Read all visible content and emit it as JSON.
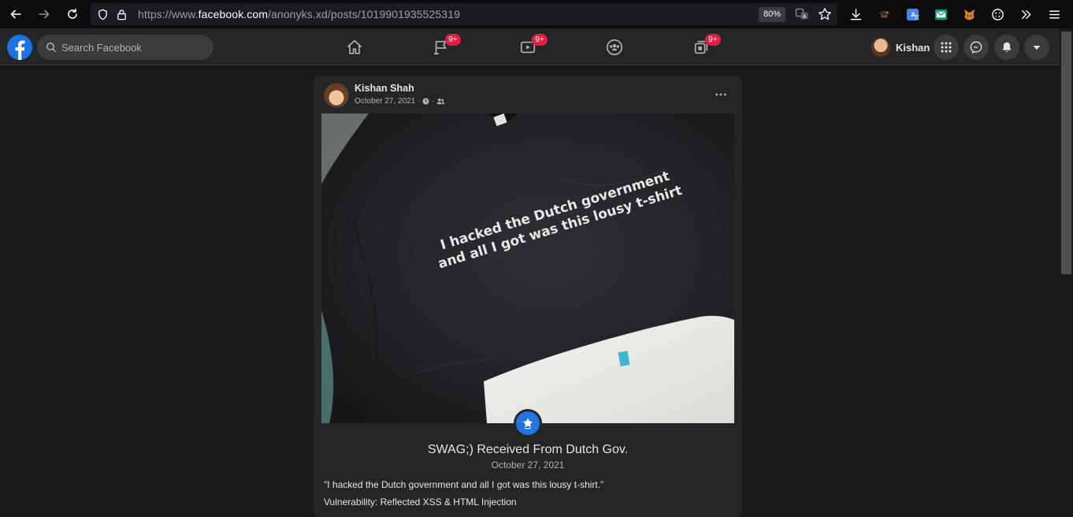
{
  "browser": {
    "url_prefix": "https://www.",
    "url_host": "facebook.com",
    "url_path": "/anonyks.xd/posts/1019901935525319",
    "zoom": "80%"
  },
  "fb": {
    "search_placeholder": "Search Facebook",
    "nav": [
      {
        "name": "home",
        "badge": ""
      },
      {
        "name": "pages",
        "badge": "9+"
      },
      {
        "name": "watch",
        "badge": "9+"
      },
      {
        "name": "groups",
        "badge": ""
      },
      {
        "name": "gaming",
        "badge": "9+"
      }
    ],
    "profile_name": "Kishan"
  },
  "post": {
    "author": "Kishan Shah",
    "date": "October 27, 2021 ·",
    "photo_caption_line1": "I hacked the Dutch government",
    "photo_caption_line2": "and all I got was this lousy t-shirt",
    "milestone_title": "SWAG;) Received From Dutch Gov.",
    "milestone_date": "October 27, 2021",
    "text_line1": "\"I hacked the Dutch government and all I got was this lousy t-shirt.\"",
    "text_line2": "Vulnerability: Reflected XSS & HTML Injection"
  },
  "colors": {
    "accent": "#1b74e4",
    "badge": "#e41e3f",
    "background": "#18191a",
    "card": "#242526"
  }
}
